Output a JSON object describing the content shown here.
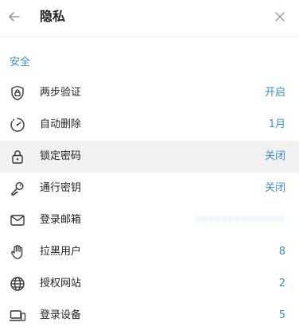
{
  "header": {
    "title": "隐私",
    "back_icon": "arrow-left-icon",
    "close_icon": "close-icon"
  },
  "section": {
    "title": "安全"
  },
  "colors": {
    "accent": "#3a8fc4",
    "highlight_row": "#f1f1f1"
  },
  "rows": [
    {
      "icon": "shield-lock-icon",
      "label": "两步验证",
      "value": "开启"
    },
    {
      "icon": "timer-icon",
      "label": "自动删除",
      "value": "1月"
    },
    {
      "icon": "lock-icon",
      "label": "锁定密码",
      "value": "关闭",
      "highlighted": true
    },
    {
      "icon": "key-icon",
      "label": "通行密钥",
      "value": "关闭"
    },
    {
      "icon": "mail-icon",
      "label": "登录邮箱",
      "value": "••••••••••••••",
      "obscured": true
    },
    {
      "icon": "hand-icon",
      "label": "拉黑用户",
      "value": "8"
    },
    {
      "icon": "globe-icon",
      "label": "授权网站",
      "value": "2"
    },
    {
      "icon": "devices-icon",
      "label": "登录设备",
      "value": "5"
    }
  ]
}
